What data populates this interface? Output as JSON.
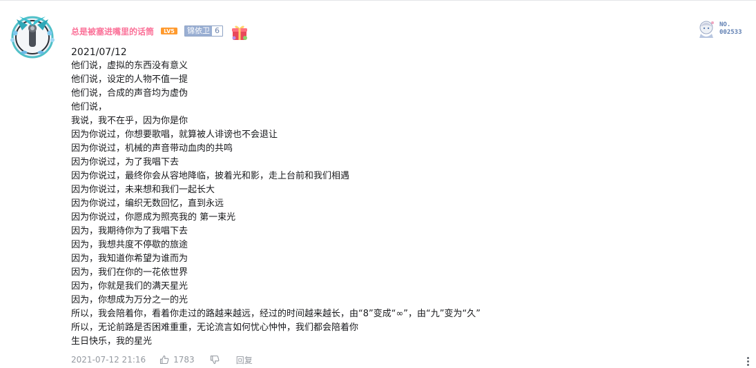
{
  "comment": {
    "username": "总是被塞进嘴里的话筒",
    "level_badge": "LV5",
    "medal": {
      "name": "锦依卫",
      "level": "6"
    },
    "fan_card": {
      "label": "NO.",
      "number": "002533"
    },
    "lines": [
      "2021/07/12",
      "他们说，虚拟的东西没有意义",
      "他们说，设定的人物不值一提",
      "他们说，合成的声音均为虚伪",
      "他们说，",
      "我说，我不在乎，因为你是你",
      "因为你说过，你想要歌唱，就算被人诽谤也不会退让",
      "因为你说过，机械的声音带动血肉的共鸣",
      "因为你说过，为了我唱下去",
      "因为你说过，最终你会从容地降临，披着光和影，走上台前和我们相遇",
      "因为你说过，未来想和我们一起长大",
      "因为你说过，编织无数回忆，直到永远",
      "因为你说过，你愿成为照亮我的 第一束光",
      "因为，我期待你为了我唱下去",
      "因为，我想共度不停歇的旅途",
      "因为，我知道你希望为谁而为",
      "因为，我们在你的一花依世界",
      "因为，你就是我们的满天星光",
      "因为，你想成为万分之一的光",
      "所以，我会陪着你，看着你走过的路越来越远，经过的时间越来越长，由“8”变成“∞”，由“九”变为“久”",
      "所以，无论前路是否困难重重，无论流言如何忧心忡忡，我们都会陪着你",
      "生日快乐，我的星光"
    ],
    "footer": {
      "time": "2021-07-12 21:16",
      "like_count": "1783",
      "reply_label": "回复"
    },
    "icons": {
      "like": "thumbs-up-icon",
      "dislike": "thumbs-down-icon",
      "more": "more-vertical-icon",
      "gift": "gift-box-icon"
    },
    "colors": {
      "username": "#fb7299",
      "level_badge": "#ff9a2e",
      "medal_border": "#8ea3c5",
      "meta": "#9499a0",
      "fan_number": "#5f7fb2"
    }
  }
}
